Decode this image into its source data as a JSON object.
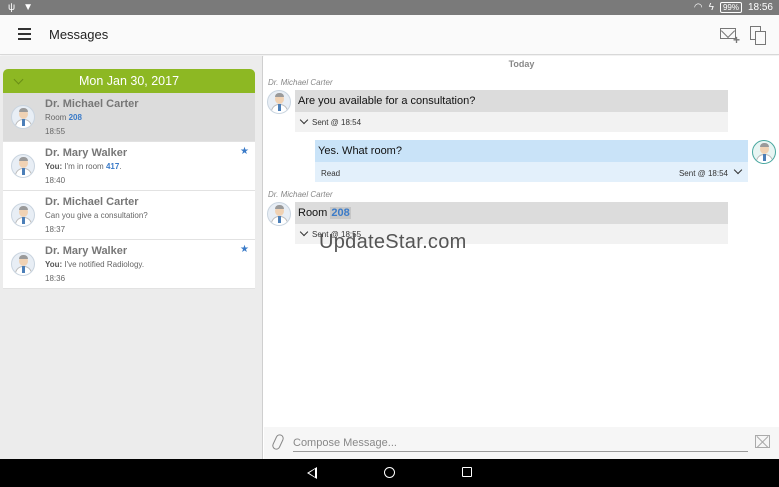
{
  "status_bar": {
    "time": "18:56",
    "battery": "99%"
  },
  "header": {
    "title": "Messages"
  },
  "sidebar": {
    "date_header": "Mon Jan 30, 2017",
    "conversations": [
      {
        "name": "Dr. Michael Carter",
        "preview_prefix": "",
        "preview_text": "Room ",
        "preview_number": "208",
        "preview_suffix": "",
        "time": "18:55",
        "starred": false,
        "selected": true
      },
      {
        "name": "Dr. Mary Walker",
        "preview_prefix": "You:",
        "preview_text": " I'm in room ",
        "preview_number": "417",
        "preview_suffix": ".",
        "time": "18:40",
        "starred": true,
        "selected": false
      },
      {
        "name": "Dr. Michael Carter",
        "preview_prefix": "",
        "preview_text": "Can you give a consultation?",
        "preview_number": "",
        "preview_suffix": "",
        "time": "18:37",
        "starred": false,
        "selected": false
      },
      {
        "name": "Dr. Mary Walker",
        "preview_prefix": "You:",
        "preview_text": " I've notified Radiology.",
        "preview_number": "",
        "preview_suffix": "",
        "time": "18:36",
        "starred": true,
        "selected": false
      }
    ]
  },
  "chat": {
    "day_label": "Today",
    "messages": [
      {
        "sender": "Dr. Michael Carter",
        "text": "Are you available for a consultation?",
        "status": "Sent @ 18:54"
      },
      {
        "text": "Yes. What room?",
        "read_label": "Read",
        "status": "Sent @ 18:54"
      },
      {
        "sender": "Dr. Michael Carter",
        "text_prefix": "Room ",
        "text_highlight": "208",
        "status": "Sent @ 18:55"
      }
    ],
    "watermark": "UpdateStar.com"
  },
  "composer": {
    "placeholder": "Compose Message..."
  },
  "colors": {
    "accent_green": "#8db823",
    "link_blue": "#3b7bc8",
    "outgoing_bubble": "#c9e3f8"
  }
}
